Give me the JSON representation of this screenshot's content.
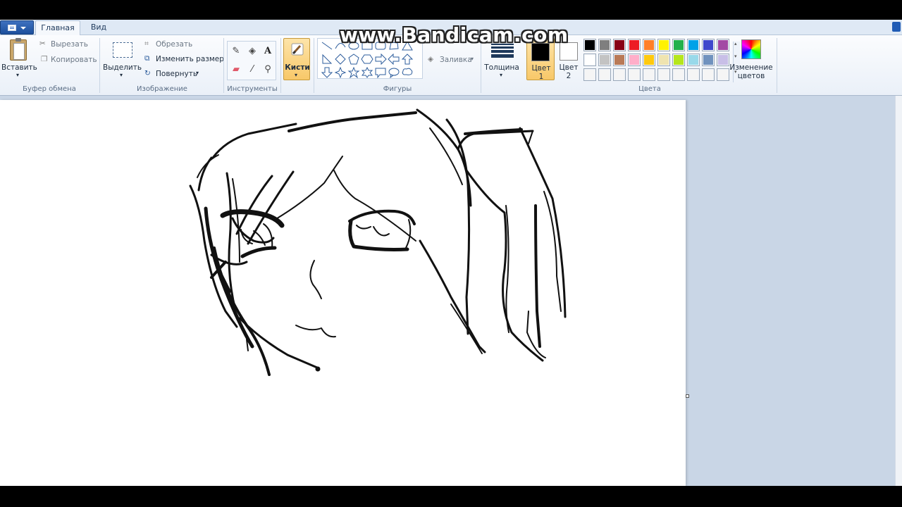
{
  "tabs": {
    "home": "Главная",
    "view": "Вид"
  },
  "watermark": "www.Bandicam.com",
  "clipboard": {
    "paste": "Вставить",
    "cut": "Вырезать",
    "copy": "Копировать",
    "group": "Буфер обмена"
  },
  "image": {
    "select": "Выделить",
    "crop": "Обрезать",
    "resize": "Изменить размер",
    "rotate": "Повернуть",
    "group": "Изображение"
  },
  "tools": {
    "group": "Инструменты"
  },
  "brushes": {
    "label": "Кисти"
  },
  "shapes": {
    "fill": "Заливка",
    "group": "Фигуры"
  },
  "thickness": {
    "label": "Толщина"
  },
  "colors": {
    "color1": "Цвет",
    "color1_num": "1",
    "color2": "Цвет",
    "color2_num": "2",
    "edit": "Изменение",
    "edit2": "цветов",
    "group": "Цвета",
    "color1_value": "#000000",
    "color2_value": "#ffffff",
    "palette_row1": [
      "#000000",
      "#7f7f7f",
      "#880015",
      "#ed1c24",
      "#ff7f27",
      "#fff200",
      "#22b14c",
      "#00a2e8",
      "#3f48cc",
      "#a349a4"
    ],
    "palette_row2": [
      "#ffffff",
      "#c3c3c3",
      "#b97a57",
      "#ffaec9",
      "#ffc90e",
      "#efe4b0",
      "#b5e61d",
      "#99d9ea",
      "#7092be",
      "#c8bfe7"
    ],
    "palette_row3": [
      "#f5f5f5",
      "#f5f5f5",
      "#f5f5f5",
      "#f5f5f5",
      "#f5f5f5",
      "#f5f5f5",
      "#f5f5f5",
      "#f5f5f5",
      "#f5f5f5",
      "#f5f5f5"
    ]
  }
}
